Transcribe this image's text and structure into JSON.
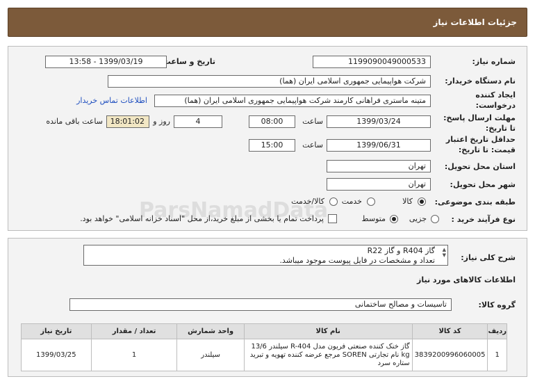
{
  "header": {
    "title": "جزئیات اطلاعات نیاز"
  },
  "fields": {
    "need_number_label": "شماره نیاز:",
    "need_number": "1199090049000533",
    "announce_label": "تاریخ و ساعت اعلان عمومی:",
    "announce_value": "1399/03/19 - 13:58",
    "buyer_label": "نام دستگاه خریدار:",
    "buyer_value": "شرکت هواپیمایی جمهوری اسلامی ایران (هما)",
    "creator_label_1": "ایجاد کننده",
    "creator_label_2": "درخواست:",
    "creator_value": "متینه ماستری فراهانی کارمند شرکت هواپیمایی جمهوری اسلامی ایران (هما)",
    "contact_link": "اطلاعات تماس خریدار",
    "reply_label_1": "مهلت ارسال پاسخ:",
    "reply_label_2": "تا تاریخ:",
    "reply_date": "1399/03/24",
    "time_label": "ساعت",
    "reply_time": "08:00",
    "days_value": "4",
    "days_label": "روز و",
    "remaining_value": "18:01:02",
    "remaining_label": "ساعت باقی مانده",
    "price_label_1": "حداقل تاریخ اعتبار",
    "price_label_2": "قیمت: تا تاریخ:",
    "price_date": "1399/06/31",
    "price_time": "15:00",
    "province_label": "استان محل تحویل:",
    "province_value": "تهران",
    "city_label": "شهر محل تحویل:",
    "city_value": "تهران",
    "category_label": "طبقه بندی موضوعی:",
    "category_options": [
      "کالا",
      "خدمت",
      "کالا/خدمت"
    ],
    "process_label": "نوع فرآیند خرید :",
    "process_options": [
      "جزیی",
      "متوسط"
    ],
    "payment_note": "پرداخت تمام یا بخشی از مبلغ خرید،از محل \"اسناد خزانه اسلامی\" خواهد بود."
  },
  "details": {
    "general_desc_label": "شرح کلی نیاز:",
    "general_desc_line1": "گاز R404 و گاز R22",
    "general_desc_line2": "تعداد و مشخصات در فایل پیوست موجود میباشد.",
    "goods_info_title": "اطلاعات کالاهای مورد نیاز",
    "goods_group_label": "گروه کالا:",
    "goods_group_value": "تاسیسات و مصالح ساختمانی"
  },
  "table": {
    "headers": [
      "ردیف",
      "کد کالا",
      "نام کالا",
      "واحد شمارش",
      "تعداد / مقدار",
      "تاریخ نیاز"
    ],
    "rows": [
      {
        "row": "1",
        "code": "3839200996060005",
        "name": "گاز خنک کننده صنعتی فریون مدل R-404 سیلندر 13/6 kg نام تجارتی SOREN مرجع عرضه کننده تهویه و تبرید ستاره سرد",
        "unit": "سیلندر",
        "qty": "1",
        "date": "1399/03/25"
      }
    ]
  },
  "watermark": "ParsNamadData"
}
